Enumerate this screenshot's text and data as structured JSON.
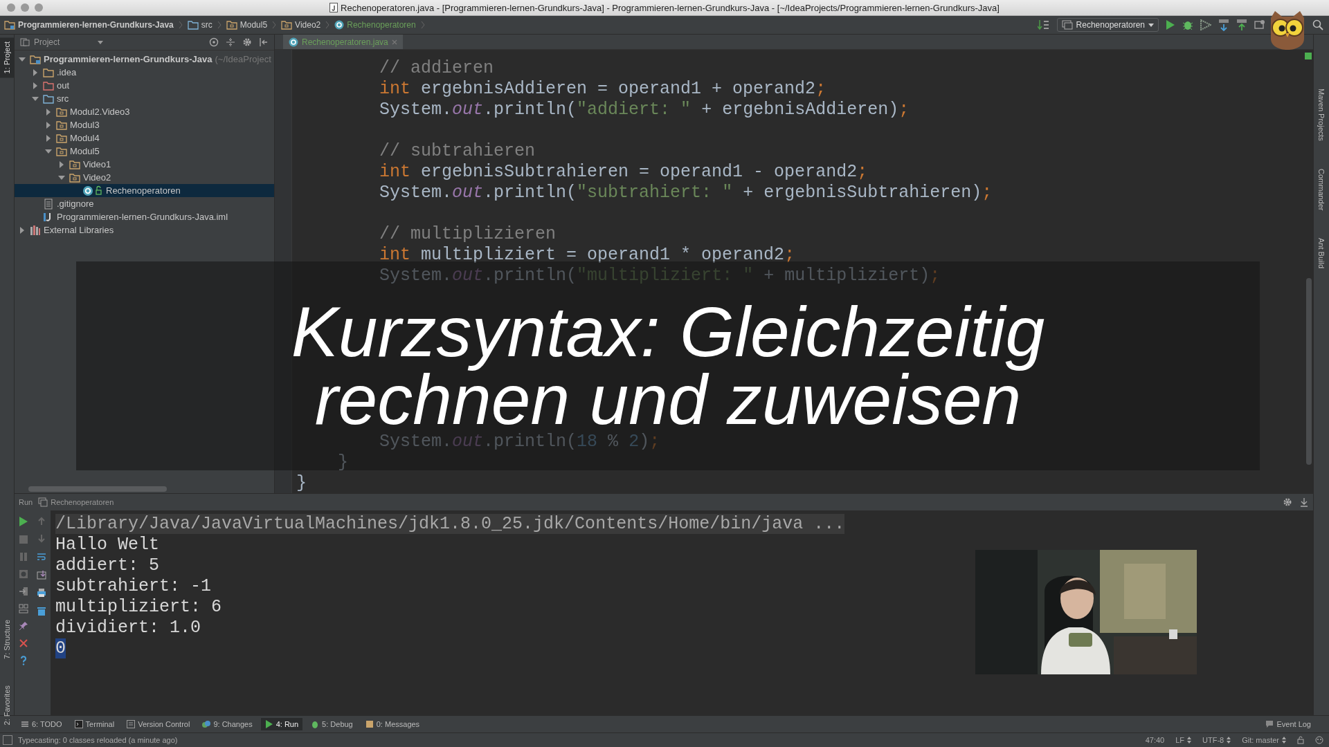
{
  "window": {
    "title": "Rechenoperatoren.java - [Programmieren-lernen-Grundkurs-Java] - Programmieren-lernen-Grundkurs-Java - [~/IdeaProjects/Programmieren-lernen-Grundkurs-Java]"
  },
  "breadcrumbs": [
    {
      "label": "Programmieren-lernen-Grundkurs-Java",
      "kind": "module"
    },
    {
      "label": "src",
      "kind": "source"
    },
    {
      "label": "Modul5",
      "kind": "package"
    },
    {
      "label": "Video2",
      "kind": "package"
    },
    {
      "label": "Rechenoperatoren",
      "kind": "class"
    }
  ],
  "run_config": "Rechenoperatoren",
  "left_stripe": [
    {
      "label": "1: Project",
      "selected": true
    },
    {
      "label": "7: Structure",
      "selected": false
    },
    {
      "label": "2: Favorites",
      "selected": false
    }
  ],
  "right_stripe": [
    "Maven Projects",
    "Commander",
    "Ant Build"
  ],
  "project_panel": {
    "title": "Project",
    "tree": [
      {
        "name": "Programmieren-lernen-Grundkurs-Java",
        "hint": "(~/IdeaProject",
        "kind": "module",
        "expanded": true,
        "selected": false,
        "children": [
          {
            "name": ".idea",
            "kind": "folder",
            "expanded": false,
            "selected": false
          },
          {
            "name": "out",
            "kind": "excluded",
            "expanded": false,
            "selected": false
          },
          {
            "name": "src",
            "kind": "source",
            "expanded": true,
            "selected": false,
            "children": [
              {
                "name": "Modul2.Video3",
                "kind": "package",
                "expanded": false,
                "selected": false
              },
              {
                "name": "Modul3",
                "kind": "package",
                "expanded": false,
                "selected": false
              },
              {
                "name": "Modul4",
                "kind": "package",
                "expanded": false,
                "selected": false
              },
              {
                "name": "Modul5",
                "kind": "package",
                "expanded": true,
                "selected": false,
                "children": [
                  {
                    "name": "Video1",
                    "kind": "package",
                    "expanded": false,
                    "selected": false
                  },
                  {
                    "name": "Video2",
                    "kind": "package",
                    "expanded": true,
                    "selected": false,
                    "children": [
                      {
                        "name": "Rechenoperatoren",
                        "kind": "class",
                        "selected": true
                      }
                    ]
                  }
                ]
              }
            ]
          },
          {
            "name": ".gitignore",
            "kind": "file",
            "selected": false
          },
          {
            "name": "Programmieren-lernen-Grundkurs-Java.iml",
            "kind": "module-file",
            "selected": false
          }
        ]
      },
      {
        "name": "External Libraries",
        "kind": "library",
        "expanded": false,
        "selected": false
      }
    ]
  },
  "editor": {
    "tab": "Rechenoperatoren.java",
    "lines": [
      {
        "kind": "body",
        "tokens": [
          {
            "text": "// addieren",
            "kind": "comment"
          }
        ]
      },
      {
        "kind": "body",
        "tokens": [
          {
            "text": "int",
            "kind": "keyword"
          },
          {
            "text": " ergebnisAddieren = operand1 + operand2",
            "kind": "plain"
          },
          {
            "text": ";",
            "kind": "keyword"
          }
        ]
      },
      {
        "kind": "body",
        "tokens": [
          {
            "text": "System.",
            "kind": "plain"
          },
          {
            "text": "out",
            "kind": "field"
          },
          {
            "text": ".println(",
            "kind": "plain"
          },
          {
            "text": "\"addiert: \"",
            "kind": "string"
          },
          {
            "text": " + ergebnisAddieren)",
            "kind": "plain"
          },
          {
            "text": ";",
            "kind": "keyword"
          }
        ]
      },
      {
        "kind": "blank"
      },
      {
        "kind": "body",
        "tokens": [
          {
            "text": "// subtrahieren",
            "kind": "comment"
          }
        ]
      },
      {
        "kind": "body",
        "tokens": [
          {
            "text": "int",
            "kind": "keyword"
          },
          {
            "text": " ergebnisSubtrahieren = operand1 - operand2",
            "kind": "plain"
          },
          {
            "text": ";",
            "kind": "keyword"
          }
        ]
      },
      {
        "kind": "body",
        "tokens": [
          {
            "text": "System.",
            "kind": "plain"
          },
          {
            "text": "out",
            "kind": "field"
          },
          {
            "text": ".println(",
            "kind": "plain"
          },
          {
            "text": "\"subtrahiert: \"",
            "kind": "string"
          },
          {
            "text": " + ergebnisSubtrahieren)",
            "kind": "plain"
          },
          {
            "text": ";",
            "kind": "keyword"
          }
        ]
      },
      {
        "kind": "blank"
      },
      {
        "kind": "body",
        "tokens": [
          {
            "text": "// multiplizieren",
            "kind": "comment"
          }
        ]
      },
      {
        "kind": "body",
        "tokens": [
          {
            "text": "int",
            "kind": "keyword"
          },
          {
            "text": " multipliziert = operand1 * operand2",
            "kind": "plain"
          },
          {
            "text": ";",
            "kind": "keyword"
          }
        ]
      },
      {
        "kind": "body",
        "tokens": [
          {
            "text": "System.",
            "kind": "plain"
          },
          {
            "text": "out",
            "kind": "field"
          },
          {
            "text": ".println(",
            "kind": "plain"
          },
          {
            "text": "\"multipliziert: \"",
            "kind": "string"
          },
          {
            "text": " + multipliziert)",
            "kind": "plain"
          },
          {
            "text": ";",
            "kind": "keyword"
          }
        ]
      },
      {
        "kind": "blank"
      },
      {
        "kind": "blank"
      },
      {
        "kind": "blank"
      },
      {
        "kind": "blank"
      },
      {
        "kind": "blank"
      },
      {
        "kind": "blank"
      },
      {
        "kind": "blank"
      },
      {
        "kind": "body",
        "tokens": [
          {
            "text": "System.",
            "kind": "plain"
          },
          {
            "text": "out",
            "kind": "field"
          },
          {
            "text": ".println(",
            "kind": "plain"
          },
          {
            "text": "18",
            "kind": "number"
          },
          {
            "text": " % ",
            "kind": "plain"
          },
          {
            "text": "2",
            "kind": "number"
          },
          {
            "text": ")",
            "kind": "plain"
          },
          {
            "text": ";",
            "kind": "keyword"
          }
        ]
      },
      {
        "kind": "block_end",
        "tokens": [
          {
            "text": "}",
            "kind": "plain"
          }
        ]
      },
      {
        "kind": "class_end",
        "tokens": [
          {
            "text": "}",
            "kind": "plain"
          }
        ]
      }
    ]
  },
  "overlay": {
    "lines": [
      "Kurzsyntax: Gleichzeitig",
      "rechnen und zuweisen"
    ]
  },
  "run_panel": {
    "label": "Run",
    "config": "Rechenoperatoren",
    "console": [
      {
        "text": "/Library/Java/JavaVirtualMachines/jdk1.8.0_25.jdk/Contents/Home/bin/java ...",
        "kind": "command",
        "selected": false
      },
      {
        "text": "Hallo Welt",
        "kind": "output",
        "selected": false
      },
      {
        "text": "addiert: 5",
        "kind": "output",
        "selected": false
      },
      {
        "text": "subtrahiert: -1",
        "kind": "output",
        "selected": false
      },
      {
        "text": "multipliziert: 6",
        "kind": "output",
        "selected": false
      },
      {
        "text": "dividiert: 1.0",
        "kind": "output",
        "selected": false
      },
      {
        "text": "0",
        "kind": "output",
        "selected": true
      }
    ]
  },
  "tool_windows": [
    {
      "label": "6: TODO",
      "kind": "todo",
      "selected": false
    },
    {
      "label": "Terminal",
      "kind": "terminal",
      "selected": false
    },
    {
      "label": "Version Control",
      "kind": "vcs",
      "selected": false
    },
    {
      "label": "9: Changes",
      "kind": "changes",
      "selected": false
    },
    {
      "label": "4: Run",
      "kind": "run",
      "selected": true
    },
    {
      "label": "5: Debug",
      "kind": "debug",
      "selected": false
    },
    {
      "label": "0: Messages",
      "kind": "messages",
      "selected": false
    }
  ],
  "event_log": "Event Log",
  "status_bar": {
    "message": "Typecasting: 0 classes reloaded (a minute ago)",
    "position": "47:40",
    "line_separator": "LF",
    "encoding": "UTF-8",
    "vcs": "Git: master"
  }
}
